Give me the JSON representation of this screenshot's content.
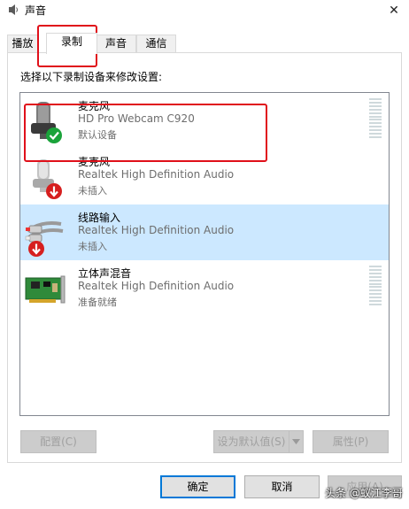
{
  "window": {
    "title": "声音",
    "close_glyph": "✕"
  },
  "tabs": [
    {
      "label": "播放",
      "active": false
    },
    {
      "label": "录制",
      "active": true
    },
    {
      "label": "声音",
      "active": false
    },
    {
      "label": "通信",
      "active": false
    }
  ],
  "panel": {
    "instruction": "选择以下录制设备来修改设置:"
  },
  "devices": [
    {
      "name": "麦克风",
      "description": "HD Pro Webcam C920",
      "status": "默认设备",
      "icon": "webcam-microphone-icon",
      "badge": "default-check-icon",
      "selected": false,
      "meter": true
    },
    {
      "name": "麦克风",
      "description": "Realtek High Definition Audio",
      "status": "未插入",
      "icon": "microphone-icon",
      "badge": "unplugged-arrow-icon",
      "selected": false,
      "meter": false
    },
    {
      "name": "线路输入",
      "description": "Realtek High Definition Audio",
      "status": "未插入",
      "icon": "line-in-cable-icon",
      "badge": "unplugged-arrow-icon",
      "selected": true,
      "meter": false
    },
    {
      "name": "立体声混音",
      "description": "Realtek High Definition Audio",
      "status": "准备就绪",
      "icon": "sound-card-icon",
      "badge": "",
      "selected": false,
      "meter": true
    }
  ],
  "buttons": {
    "configure": "配置(C)",
    "set_default": "设为默认值(S)",
    "properties": "属性(P)",
    "ok": "确定",
    "cancel": "取消",
    "apply": "应用(A)"
  },
  "watermark": "头条 @蚁江李哥",
  "colors": {
    "selection": "#cce8ff",
    "highlight": "#e0101a",
    "default_badge": "#1aa33a",
    "unplugged_badge": "#d61f1f",
    "focus": "#0078d7"
  }
}
